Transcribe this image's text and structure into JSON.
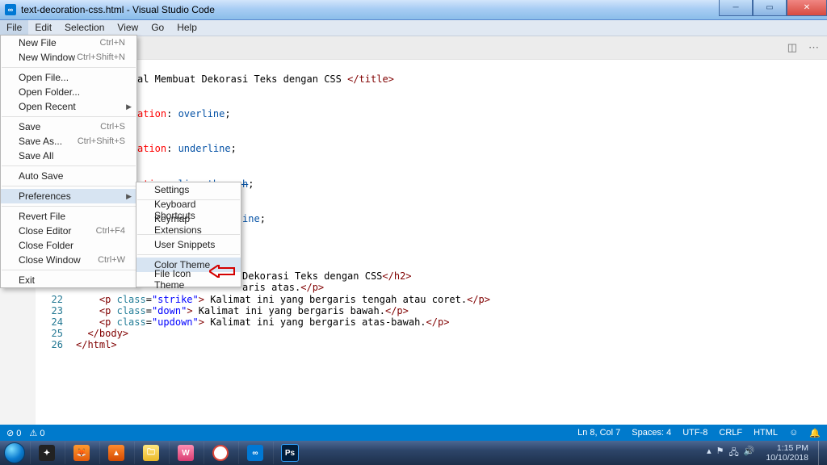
{
  "window": {
    "title": "text-decoration-css.html - Visual Studio Code"
  },
  "menubar": {
    "items": [
      "File",
      "Edit",
      "Selection",
      "View",
      "Go",
      "Help"
    ],
    "active_index": 0
  },
  "tabbar": {
    "icons": [
      "split",
      "more"
    ]
  },
  "file_menu": {
    "groups": [
      [
        {
          "label": "New File",
          "shortcut": "Ctrl+N",
          "id": "new-file"
        },
        {
          "label": "New Window",
          "shortcut": "Ctrl+Shift+N",
          "id": "new-window"
        }
      ],
      [
        {
          "label": "Open File...",
          "id": "open-file"
        },
        {
          "label": "Open Folder...",
          "id": "open-folder"
        },
        {
          "label": "Open Recent",
          "id": "open-recent",
          "submenu": true
        }
      ],
      [
        {
          "label": "Save",
          "shortcut": "Ctrl+S",
          "id": "save"
        },
        {
          "label": "Save As...",
          "shortcut": "Ctrl+Shift+S",
          "id": "save-as"
        },
        {
          "label": "Save All",
          "id": "save-all"
        }
      ],
      [
        {
          "label": "Auto Save",
          "id": "auto-save"
        }
      ],
      [
        {
          "label": "Preferences",
          "id": "preferences",
          "submenu": true,
          "hover": true
        }
      ],
      [
        {
          "label": "Revert File",
          "id": "revert-file"
        },
        {
          "label": "Close Editor",
          "shortcut": "Ctrl+F4",
          "id": "close-editor"
        },
        {
          "label": "Close Folder",
          "id": "close-folder"
        },
        {
          "label": "Close Window",
          "shortcut": "Ctrl+W",
          "id": "close-window"
        }
      ],
      [
        {
          "label": "Exit",
          "id": "exit"
        }
      ]
    ]
  },
  "pref_menu": {
    "groups": [
      [
        {
          "label": "Settings",
          "id": "settings"
        }
      ],
      [
        {
          "label": "Keyboard Shortcuts",
          "id": "kb-shortcuts"
        },
        {
          "label": "Keymap Extensions",
          "id": "keymap-ext"
        }
      ],
      [
        {
          "label": "User Snippets",
          "id": "user-snippets"
        }
      ],
      [
        {
          "label": "Color Theme",
          "id": "color-theme",
          "hover": true
        },
        {
          "label": "File Icon Theme",
          "id": "file-icon-theme"
        }
      ]
    ]
  },
  "gutter": {
    "visible_lines": [
      22,
      23,
      24,
      25,
      26
    ]
  },
  "code_fragments": {
    "r1_txt": "al Membuat Dekorasi Teks dengan CSS ",
    "r1_ct": "</title>",
    "r2_pre": "ation",
    "r2_val": "overline",
    "r3_pre": "ation",
    "r3_val": "underline",
    "r4_pre": "ation",
    "r4_val": "line-through",
    "r5_right": "ine",
    "r6_txt": "Dekorasi Teks dengan CSS",
    "r6_ct": "</h2>",
    "r7_txt": "aris atas.",
    "r7_ct": "</p>",
    "l22_before": "<p ",
    "l22_aname": "class",
    "l22_astr": "\"strike\"",
    "l22_txt": " Kalimat ini yang bergaris tengah atau coret.",
    "l22_ct": "</p>",
    "l23_before": "<p ",
    "l23_aname": "class",
    "l23_astr": "\"down\"",
    "l23_txt": " Kalimat ini yang bergaris bawah.",
    "l23_ct": "</p>",
    "l24_before": "<p ",
    "l24_aname": "class",
    "l24_astr": "\"updown\"",
    "l24_txt": " Kalimat ini yang bergaris atas-bawah.",
    "l24_ct": "</p>",
    "l25": "</body>",
    "l26": "</html>"
  },
  "status": {
    "errors": "0",
    "warnings": "0",
    "cursor": "Ln 8, Col 7",
    "spaces": "Spaces: 4",
    "enc": "UTF-8",
    "eol": "CRLF",
    "lang": "HTML"
  },
  "taskbar": {
    "time": "1:15 PM",
    "date": "10/10/2018"
  }
}
